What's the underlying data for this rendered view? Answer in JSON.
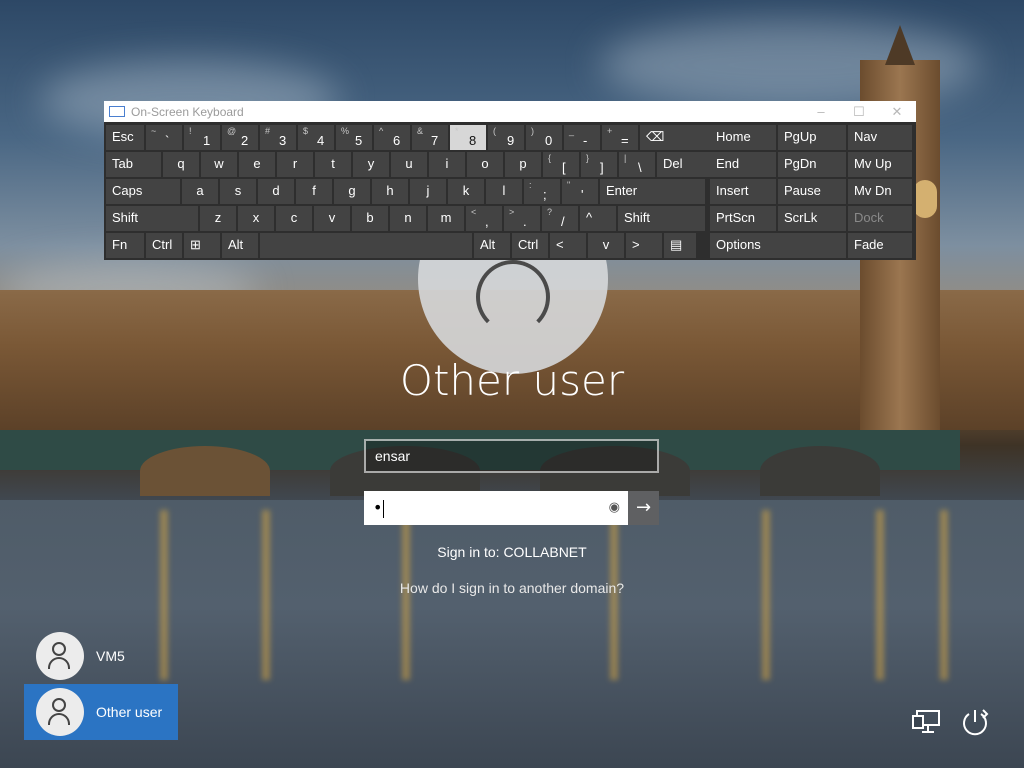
{
  "osk": {
    "title": "On-Screen Keyboard",
    "window_buttons": [
      "–",
      "☐",
      "✕"
    ],
    "rows": [
      [
        {
          "main": "Esc"
        },
        {
          "sub": "~",
          "main": "`"
        },
        {
          "sub": "!",
          "main": "1"
        },
        {
          "sub": "@",
          "main": "2"
        },
        {
          "sub": "#",
          "main": "3"
        },
        {
          "sub": "$",
          "main": "4"
        },
        {
          "sub": "%",
          "main": "5"
        },
        {
          "sub": "^",
          "main": "6"
        },
        {
          "sub": "&",
          "main": "7"
        },
        {
          "sub": "*",
          "main": "8"
        },
        {
          "sub": "(",
          "main": "9"
        },
        {
          "sub": ")",
          "main": "0"
        },
        {
          "sub": "_",
          "main": "-"
        },
        {
          "sub": "+",
          "main": "="
        },
        {
          "main": "⌫"
        }
      ],
      [
        {
          "main": "Tab"
        },
        {
          "main": "q"
        },
        {
          "main": "w"
        },
        {
          "main": "e"
        },
        {
          "main": "r"
        },
        {
          "main": "t"
        },
        {
          "main": "y"
        },
        {
          "main": "u"
        },
        {
          "main": "i"
        },
        {
          "main": "o"
        },
        {
          "main": "p"
        },
        {
          "sub": "{",
          "main": "["
        },
        {
          "sub": "}",
          "main": "]"
        },
        {
          "sub": "|",
          "main": "\\"
        },
        {
          "main": "Del"
        }
      ],
      [
        {
          "main": "Caps"
        },
        {
          "main": "a"
        },
        {
          "main": "s"
        },
        {
          "main": "d"
        },
        {
          "main": "f"
        },
        {
          "main": "g"
        },
        {
          "main": "h"
        },
        {
          "main": "j"
        },
        {
          "main": "k"
        },
        {
          "main": "l"
        },
        {
          "sub": ":",
          "main": ";"
        },
        {
          "sub": "\"",
          "main": "'"
        },
        {
          "main": "Enter"
        }
      ],
      [
        {
          "main": "Shift"
        },
        {
          "main": "z"
        },
        {
          "main": "x"
        },
        {
          "main": "c"
        },
        {
          "main": "v"
        },
        {
          "main": "b"
        },
        {
          "main": "n"
        },
        {
          "main": "m"
        },
        {
          "sub": "<",
          "main": ","
        },
        {
          "sub": ">",
          "main": "."
        },
        {
          "sub": "?",
          "main": "/"
        },
        {
          "main": "^"
        },
        {
          "main": "Shift"
        }
      ],
      [
        {
          "main": "Fn"
        },
        {
          "main": "Ctrl"
        },
        {
          "main": "⊞"
        },
        {
          "main": "Alt"
        },
        {
          "main": ""
        },
        {
          "main": "Alt"
        },
        {
          "main": "Ctrl"
        },
        {
          "main": "<"
        },
        {
          "main": "v"
        },
        {
          "main": ">"
        },
        {
          "main": "▤"
        }
      ]
    ],
    "nav_keys": [
      [
        "Home",
        "PgUp",
        "Nav"
      ],
      [
        "End",
        "PgDn",
        "Mv Up"
      ],
      [
        "Insert",
        "Pause",
        "Mv Dn"
      ],
      [
        "PrtScn",
        "ScrLk",
        "Dock"
      ],
      [
        "Options",
        "Fade"
      ]
    ]
  },
  "login": {
    "user_title": "Other user",
    "username_value": "ensar",
    "password_mask": "•",
    "reveal_icon": "eye-icon",
    "submit_icon": "arrow-right-icon",
    "sign_in_to": "Sign in to: COLLABNET",
    "domain_link": "How do I sign in to another domain?"
  },
  "users": [
    {
      "name": "VM5",
      "active": false
    },
    {
      "name": "Other user",
      "active": true
    }
  ],
  "system_icons": [
    "network-icon",
    "power-icon"
  ],
  "colors": {
    "accent": "#2b74c3",
    "osk_bg": "#2e2e2e",
    "key_bg": "#434343"
  }
}
